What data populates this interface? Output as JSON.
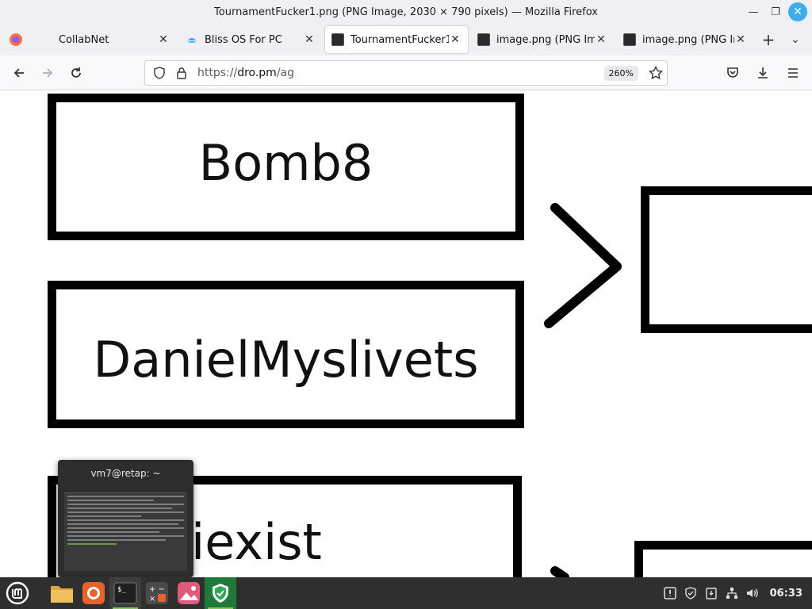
{
  "window": {
    "title": "TournamentFucker1.png (PNG Image, 2030 × 790 pixels) — Mozilla Firefox"
  },
  "tabs": [
    {
      "label": "CollabNet",
      "active": false,
      "favicon": "blank"
    },
    {
      "label": "Bliss OS For PC",
      "active": false,
      "favicon": "bliss-icon"
    },
    {
      "label": "TournamentFucker1",
      "active": true,
      "favicon": "image-thumb"
    },
    {
      "label": "image.png (PNG Ima",
      "active": false,
      "favicon": "image-thumb"
    },
    {
      "label": "image.png (PNG Ima",
      "active": false,
      "favicon": "image-thumb"
    }
  ],
  "navbar": {
    "url_prefix": "https://",
    "url_host": "dro.pm",
    "url_path": "/ag",
    "zoom": "260%"
  },
  "content": {
    "bracket_names": [
      "Bomb8",
      "DanielMyslivets",
      "iexist"
    ]
  },
  "terminal_preview": {
    "title": "vm7@retap: ~"
  },
  "taskbar": {
    "clock": "06:33"
  },
  "colors": {
    "accent": "#3daee9",
    "taskbar": "#2f2f2f",
    "mint_green": "#8fbf5e"
  }
}
